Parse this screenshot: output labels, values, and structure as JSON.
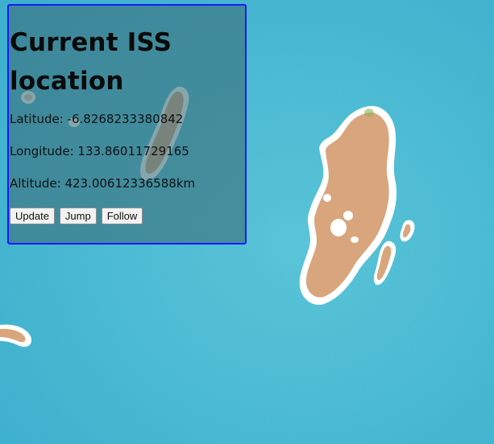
{
  "map": {
    "water_color": "#4cbcd6",
    "land_color": "#dca57a",
    "coast_color": "#ffffff"
  },
  "panel": {
    "title": "Current ISS location",
    "latitude": "Latitude: -6.8268233380842",
    "longitude": "Longitude: 133.86011729165",
    "altitude": "Altitude: 423.00612336588km",
    "border_color": "#1a1aff"
  },
  "buttons": {
    "update_label": "Update",
    "jump_label": "Jump",
    "follow_label": "Follow"
  }
}
